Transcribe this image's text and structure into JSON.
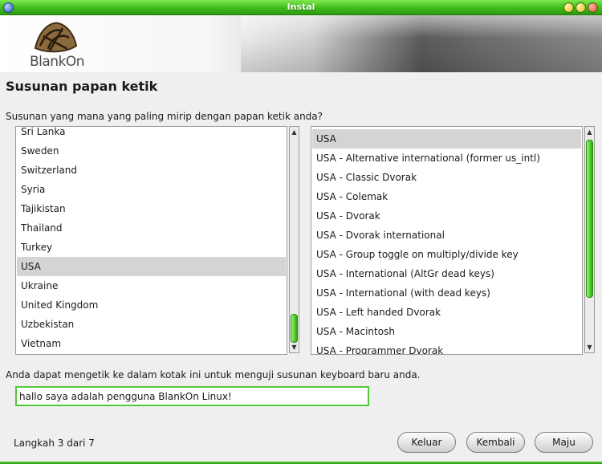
{
  "window": {
    "title": "Instal"
  },
  "banner": {
    "logo_text": "BlankOn"
  },
  "page": {
    "heading": "Susunan papan ketik",
    "question": "Susunan yang mana yang paling mirip dengan papan ketik anda?"
  },
  "layouts": {
    "items": [
      "Sri Lanka",
      "Sweden",
      "Switzerland",
      "Syria",
      "Tajikistan",
      "Thailand",
      "Turkey",
      "USA",
      "Ukraine",
      "United Kingdom",
      "Uzbekistan",
      "Vietnam"
    ],
    "selected": "USA"
  },
  "variants": {
    "items": [
      "USA",
      "USA - Alternative international (former us_intl)",
      "USA - Classic Dvorak",
      "USA - Colemak",
      "USA - Dvorak",
      "USA - Dvorak international",
      "USA - Group toggle on multiply/divide key",
      "USA - International (AltGr dead keys)",
      "USA - International (with dead keys)",
      "USA - Left handed Dvorak",
      "USA - Macintosh",
      "USA - Programmer Dvorak"
    ],
    "selected": "USA"
  },
  "test": {
    "hint": "Anda dapat mengetik ke dalam kotak ini untuk menguji susunan keyboard baru anda.",
    "value": "hallo saya adalah pengguna BlankOn Linux!"
  },
  "footer": {
    "step": "Langkah 3 dari 7",
    "quit_label": "Keluar",
    "back_label": "Kembali",
    "forward_label": "Maju"
  },
  "colors": {
    "titlebar": "#3fbb1c",
    "accent_green": "#55c83a",
    "selection": "#d4d4d4"
  }
}
